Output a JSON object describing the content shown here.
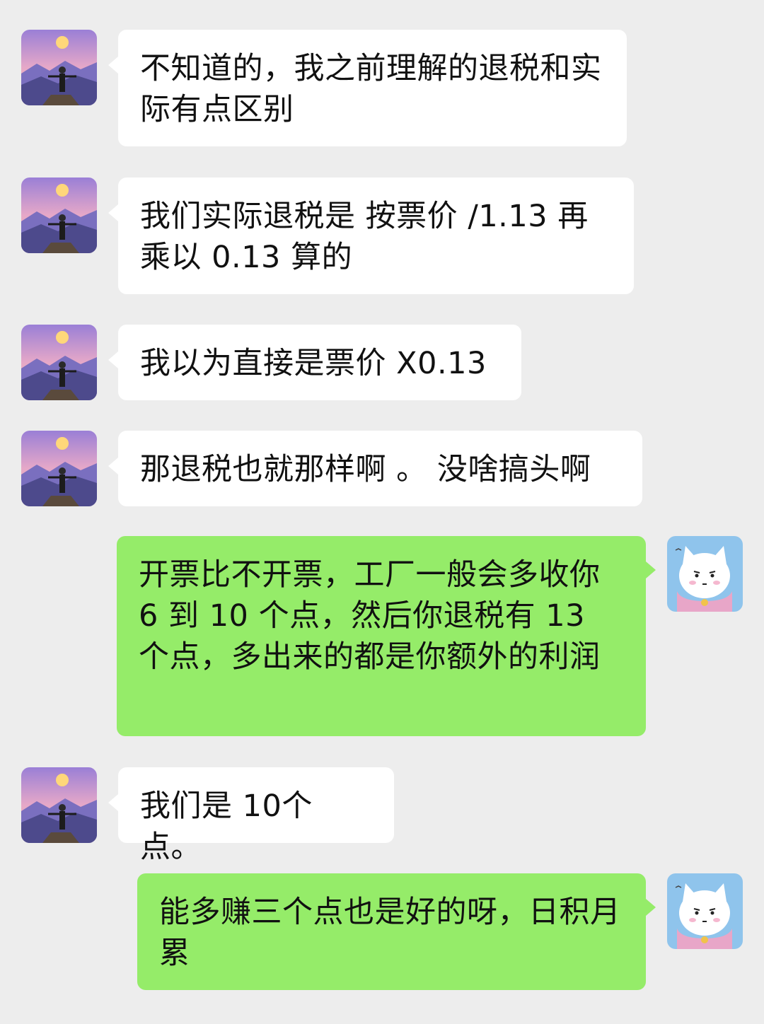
{
  "messages": [
    {
      "sender": "other",
      "avatar": "mountain-person-avatar",
      "text": "不知道的，我之前理解的退税和实际有点区别"
    },
    {
      "sender": "other",
      "avatar": "mountain-person-avatar",
      "text": "我们实际退税是  按票价 /1.13  再乘以 0.13 算的"
    },
    {
      "sender": "other",
      "avatar": "mountain-person-avatar",
      "text": "我以为直接是票价 X0.13"
    },
    {
      "sender": "other",
      "avatar": "mountain-person-avatar",
      "text": "那退税也就那样啊 。 没啥搞头啊"
    },
    {
      "sender": "self",
      "avatar": "cat-avatar",
      "text": "开票比不开票，工厂一般会多收你 6 到 10 个点，然后你退税有 13 个点，多出来的都是你额外的利润"
    },
    {
      "sender": "other",
      "avatar": "mountain-person-avatar",
      "text": "我们是 10个点。"
    },
    {
      "sender": "self",
      "avatar": "cat-avatar",
      "text": "能多赚三个点也是好的呀，日积月累"
    }
  ],
  "colors": {
    "background": "#ededed",
    "incoming_bubble": "#ffffff",
    "outgoing_bubble": "#95ec69"
  }
}
